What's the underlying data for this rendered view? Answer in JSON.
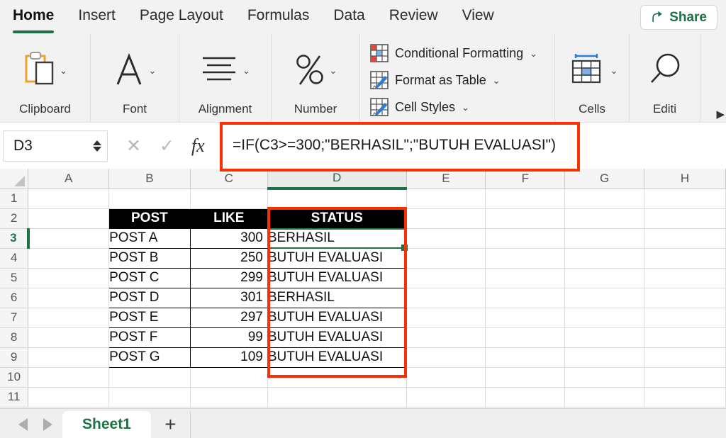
{
  "ribbon": {
    "tabs": [
      {
        "label": "Home",
        "active": true
      },
      {
        "label": "Insert",
        "active": false
      },
      {
        "label": "Page Layout",
        "active": false
      },
      {
        "label": "Formulas",
        "active": false
      },
      {
        "label": "Data",
        "active": false
      },
      {
        "label": "Review",
        "active": false
      },
      {
        "label": "View",
        "active": false
      }
    ],
    "share_label": "Share",
    "share_icon": "share-icon",
    "groups": [
      {
        "label": "Clipboard",
        "icon": "clipboard-icon",
        "caret": "⌄"
      },
      {
        "label": "Font",
        "icon": "font-a-icon",
        "caret": "⌄"
      },
      {
        "label": "Alignment",
        "icon": "alignment-lines-icon",
        "caret": "⌄"
      },
      {
        "label": "Number",
        "icon": "percent-icon",
        "caret": "⌄"
      },
      {
        "label": "Cells",
        "icon": "cells-table-icon",
        "caret": "⌄"
      },
      {
        "label": "Editi",
        "icon": "magnifier-icon",
        "caret": ""
      }
    ],
    "styles_items": [
      {
        "label": "Conditional Formatting",
        "icon": "conditional-formatting-icon",
        "caret": "⌄"
      },
      {
        "label": "Format as Table",
        "icon": "format-as-table-icon",
        "caret": "⌄"
      },
      {
        "label": "Cell Styles",
        "icon": "cell-styles-icon",
        "caret": "⌄"
      }
    ],
    "overflow_arrow": "▶"
  },
  "formula_bar": {
    "name_box_value": "D3",
    "cancel_icon": "✕",
    "confirm_icon": "✓",
    "fx_label": "fx",
    "formula": "=IF(C3>=300;\"BERHASIL\";\"BUTUH EVALUASI\")"
  },
  "grid": {
    "columns": [
      "A",
      "B",
      "C",
      "D",
      "E",
      "F",
      "G",
      "H"
    ],
    "selected_column": "D",
    "rows": [
      "1",
      "2",
      "3",
      "4",
      "5",
      "6",
      "7",
      "8",
      "9",
      "10",
      "11"
    ],
    "selected_row": "3",
    "table": {
      "headers": {
        "B": "POST",
        "C": "LIKE",
        "D": "STATUS"
      },
      "data": [
        {
          "row": "3",
          "B": "POST A",
          "C": "300",
          "D": "BERHASIL"
        },
        {
          "row": "4",
          "B": "POST B",
          "C": "250",
          "D": "BUTUH EVALUASI"
        },
        {
          "row": "5",
          "B": "POST C",
          "C": "299",
          "D": "BUTUH EVALUASI"
        },
        {
          "row": "6",
          "B": "POST D",
          "C": "301",
          "D": "BERHASIL"
        },
        {
          "row": "7",
          "B": "POST E",
          "C": "297",
          "D": "BUTUH EVALUASI"
        },
        {
          "row": "8",
          "B": "POST F",
          "C": "99",
          "D": "BUTUH EVALUASI"
        },
        {
          "row": "9",
          "B": "POST G",
          "C": "109",
          "D": "BUTUH EVALUASI"
        }
      ]
    }
  },
  "sheet_bar": {
    "prev_icon": "prev-sheet-icon",
    "next_icon": "next-sheet-icon",
    "tabs": [
      {
        "label": "Sheet1",
        "active": true
      }
    ],
    "add_label": "+"
  },
  "colors": {
    "accent_green": "#1e7145",
    "annotation_red": "#fa3005",
    "ribbon_bg": "#f2f2f2",
    "header_black": "#000000"
  }
}
